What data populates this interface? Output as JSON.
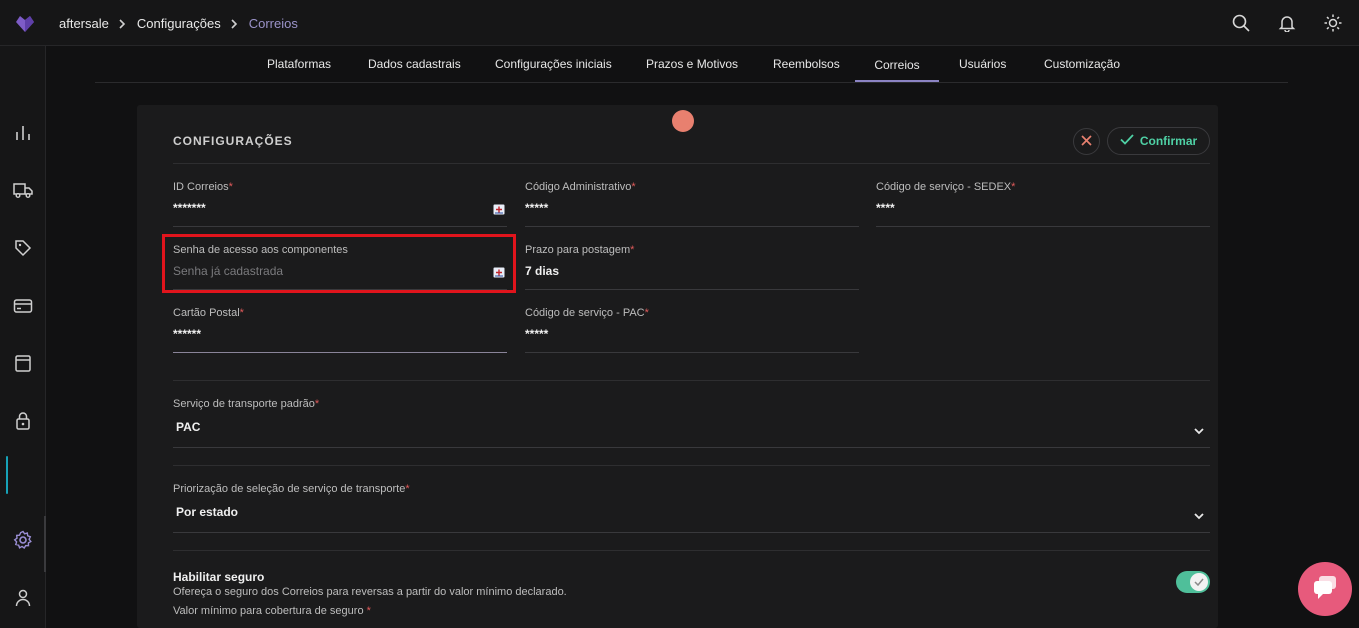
{
  "breadcrumb": [
    "aftersale",
    "Configurações",
    "Correios"
  ],
  "tabs": [
    "Plataformas",
    "Dados cadastrais",
    "Configurações iniciais",
    "Prazos e Motivos",
    "Reembolsos",
    "Correios",
    "Usuários",
    "Customização"
  ],
  "active_tab": "Correios",
  "section": {
    "title": "CONFIGURAÇÕES",
    "confirm_label": "Confirmar"
  },
  "fields": {
    "id_correios": {
      "label": "ID Correios",
      "required": "*",
      "value": "*******"
    },
    "codigo_admin": {
      "label": "Código Administrativo",
      "required": "*",
      "value": "*****"
    },
    "codigo_sedex": {
      "label": "Código de serviço - SEDEX",
      "required": "*",
      "value": "****"
    },
    "senha": {
      "label": "Senha de acesso aos componentes",
      "placeholder": "Senha já cadastrada"
    },
    "prazo": {
      "label": "Prazo para postagem",
      "required": "*",
      "value": "7 dias"
    },
    "cartao": {
      "label": "Cartão Postal",
      "required": "*",
      "value": "******"
    },
    "codigo_pac": {
      "label": "Código de serviço - PAC",
      "required": "*",
      "value": "*****"
    }
  },
  "selects": {
    "transporte": {
      "label": "Serviço de transporte padrão",
      "required": "*",
      "value": "PAC"
    },
    "priorizacao": {
      "label": "Priorização de seleção de serviço de transporte",
      "required": "*",
      "value": "Por estado"
    }
  },
  "insurance": {
    "title": "Habilitar seguro",
    "description": "Ofereça o seguro dos Correios para reversas a partir do valor mínimo declarado.",
    "min_label": "Valor mínimo para cobertura de seguro",
    "required": "*",
    "enabled": true
  },
  "colors": {
    "accent": "#8c84c4",
    "confirm": "#4fd1a5",
    "toggle": "#4fbf9a",
    "highlight": "#e1141c",
    "chat": "#e75a7c"
  }
}
